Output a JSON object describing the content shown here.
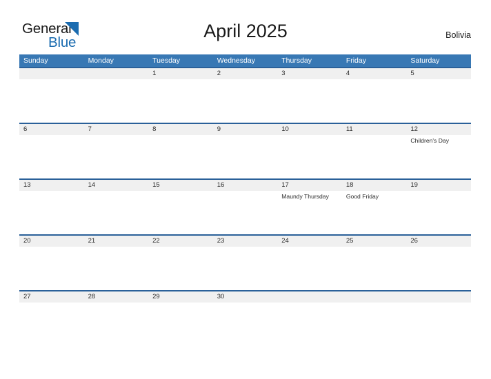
{
  "brand": {
    "name_part1": "General",
    "name_part2": "Blue",
    "triangle_color": "#1b6cb0"
  },
  "header": {
    "title": "April 2025",
    "country": "Bolivia"
  },
  "theme": {
    "header_blue": "#3878b4",
    "row_line_blue": "#2a6099",
    "day_band_gray": "#f0f0f0",
    "text_color": "#2b2b2b"
  },
  "weekdays": [
    "Sunday",
    "Monday",
    "Tuesday",
    "Wednesday",
    "Thursday",
    "Friday",
    "Saturday"
  ],
  "weeks": [
    {
      "days": [
        {
          "date": "",
          "events": []
        },
        {
          "date": "",
          "events": []
        },
        {
          "date": "1",
          "events": []
        },
        {
          "date": "2",
          "events": []
        },
        {
          "date": "3",
          "events": []
        },
        {
          "date": "4",
          "events": []
        },
        {
          "date": "5",
          "events": []
        }
      ]
    },
    {
      "days": [
        {
          "date": "6",
          "events": []
        },
        {
          "date": "7",
          "events": []
        },
        {
          "date": "8",
          "events": []
        },
        {
          "date": "9",
          "events": []
        },
        {
          "date": "10",
          "events": []
        },
        {
          "date": "11",
          "events": []
        },
        {
          "date": "12",
          "events": [
            "Children's Day"
          ]
        }
      ]
    },
    {
      "days": [
        {
          "date": "13",
          "events": []
        },
        {
          "date": "14",
          "events": []
        },
        {
          "date": "15",
          "events": []
        },
        {
          "date": "16",
          "events": []
        },
        {
          "date": "17",
          "events": [
            "Maundy Thursday"
          ]
        },
        {
          "date": "18",
          "events": [
            "Good Friday"
          ]
        },
        {
          "date": "19",
          "events": []
        }
      ]
    },
    {
      "days": [
        {
          "date": "20",
          "events": []
        },
        {
          "date": "21",
          "events": []
        },
        {
          "date": "22",
          "events": []
        },
        {
          "date": "23",
          "events": []
        },
        {
          "date": "24",
          "events": []
        },
        {
          "date": "25",
          "events": []
        },
        {
          "date": "26",
          "events": []
        }
      ]
    },
    {
      "days": [
        {
          "date": "27",
          "events": []
        },
        {
          "date": "28",
          "events": []
        },
        {
          "date": "29",
          "events": []
        },
        {
          "date": "30",
          "events": []
        },
        {
          "date": "",
          "events": []
        },
        {
          "date": "",
          "events": []
        },
        {
          "date": "",
          "events": []
        }
      ]
    }
  ]
}
